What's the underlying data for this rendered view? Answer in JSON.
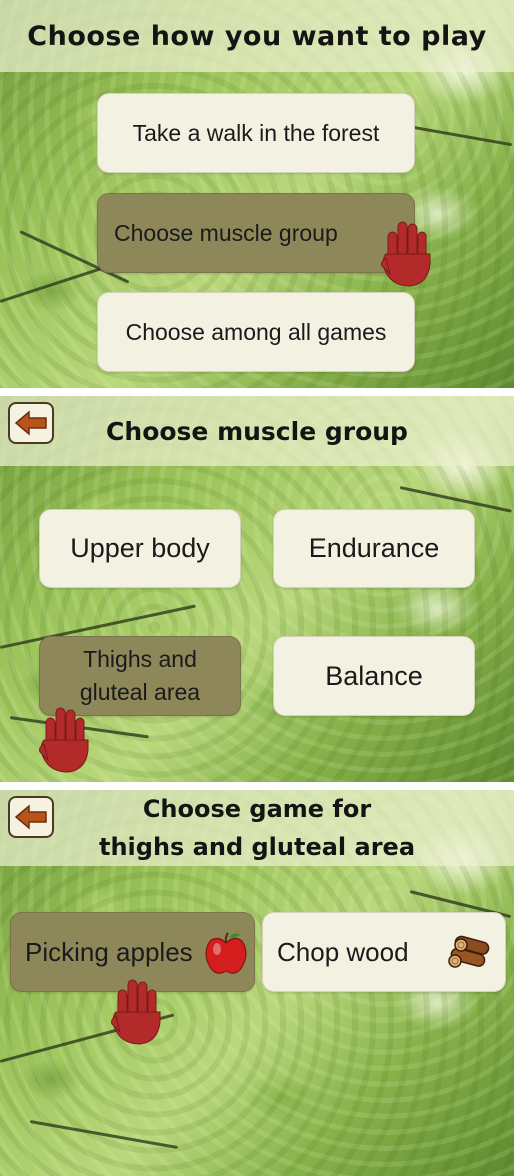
{
  "panel1": {
    "title": "Choose how you want to play",
    "options": [
      {
        "label": "Take a walk in the forest"
      },
      {
        "label": "Choose muscle group"
      },
      {
        "label": "Choose among all games"
      }
    ]
  },
  "panel2": {
    "title": "Choose muscle group",
    "options": [
      {
        "label": "Upper body"
      },
      {
        "label": "Endurance"
      },
      {
        "label": "Thighs and gluteal area"
      },
      {
        "label": "Balance"
      }
    ]
  },
  "panel3": {
    "title_line1": "Choose game for",
    "title_line2": "thighs and gluteal area",
    "options": [
      {
        "label": "Picking apples",
        "icon": "apple-icon"
      },
      {
        "label": "Chop wood",
        "icon": "wood-logs-icon"
      }
    ]
  },
  "colors": {
    "selected_button": "#8e875a",
    "button": "#f3f1e2",
    "hand_cursor": "#b22a2a",
    "back_arrow": "#b8531c"
  },
  "icons": [
    "back-arrow-icon",
    "hand-cursor-icon",
    "apple-icon",
    "wood-logs-icon"
  ]
}
